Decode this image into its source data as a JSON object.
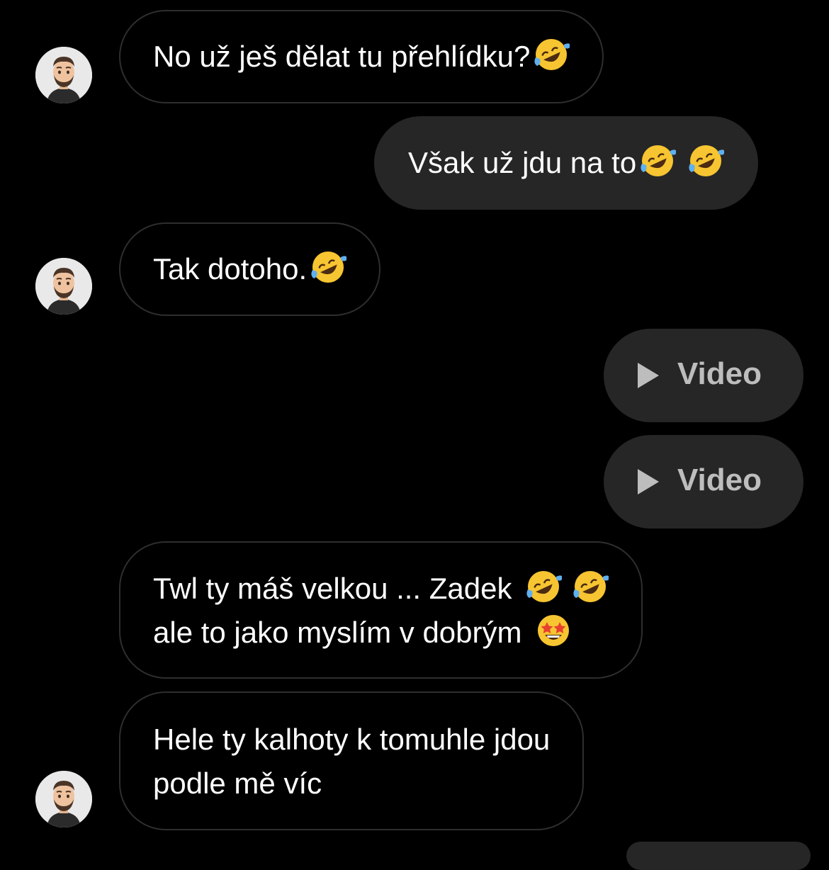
{
  "messages": [
    {
      "side": "in",
      "text": "No už ješ dělat tu přehlídku?",
      "emoji": [
        "rofl-emoji"
      ]
    },
    {
      "side": "out",
      "text": "Však už jdu na to",
      "emoji": [
        "rofl-emoji",
        "rofl-emoji"
      ]
    },
    {
      "side": "in",
      "text": "Tak dotoho.",
      "emoji": [
        "rofl-emoji"
      ]
    },
    {
      "side": "out",
      "type": "video",
      "label": "Video"
    },
    {
      "side": "out",
      "type": "video",
      "label": "Video"
    },
    {
      "side": "in",
      "lines": [
        "Twl ty máš velkou ... Zadek",
        "ale to jako myslím v dobrým"
      ],
      "emoji": [
        "rofl-emoji",
        "rofl-emoji",
        "star-struck-emoji"
      ]
    },
    {
      "side": "in",
      "lines": [
        "Hele ty kalhoty k tomuhle jdou",
        "podle mě víc"
      ]
    }
  ],
  "colors": {
    "background": "#000000",
    "incoming_border": "#2e2e2e",
    "outgoing_bubble": "#262626",
    "video_label": "#bdbdbd"
  }
}
